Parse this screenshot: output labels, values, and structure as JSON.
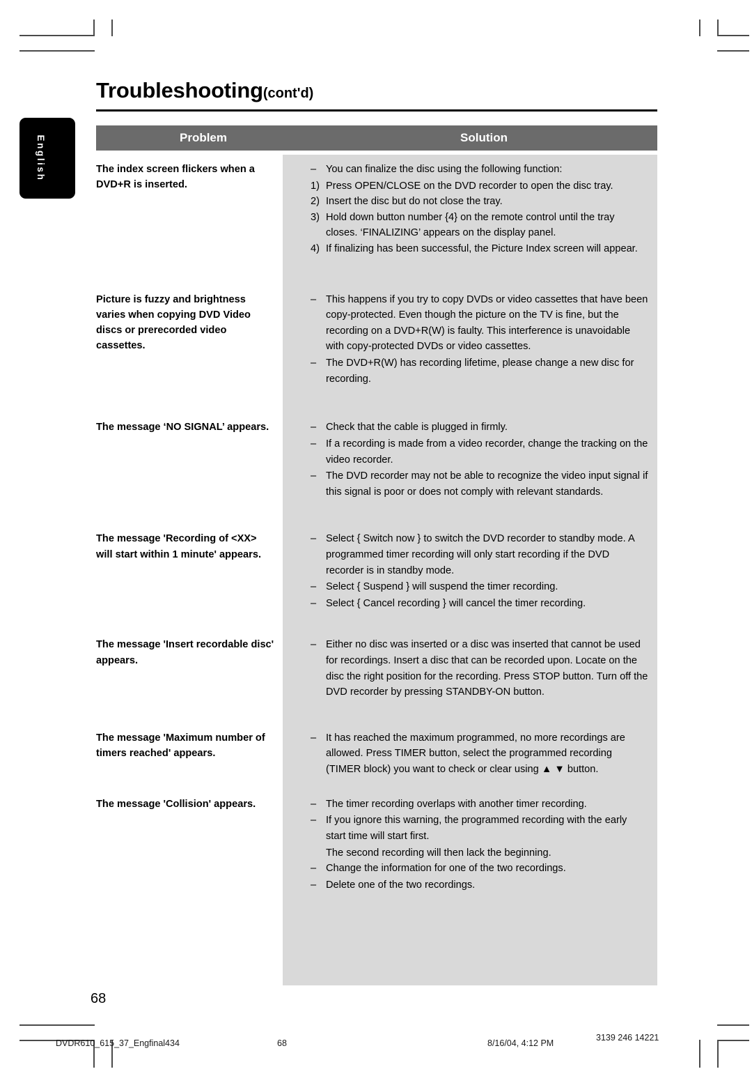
{
  "document": {
    "language_tab": "English",
    "title": "Troubleshooting",
    "title_suffix": "(cont'd)",
    "page_number": "68"
  },
  "colors": {
    "header_bar": "#6b6b6b",
    "solution_background": "#d9d9d9",
    "tab_background": "#000000",
    "text": "#000000"
  },
  "table": {
    "columns": {
      "problem": "Problem",
      "solution": "Solution"
    },
    "rows": [
      {
        "problem": "The index screen flickers when a DVD+R is inserted.",
        "solution_blocks": [
          {
            "kind": "bullet",
            "marker": "–",
            "text": "You can finalize the disc using the following function:"
          },
          {
            "kind": "numbered",
            "marker": "1)",
            "text": "Press OPEN/CLOSE on the DVD recorder to open the disc tray."
          },
          {
            "kind": "numbered",
            "marker": "2)",
            "text": "Insert the disc but do not close the tray."
          },
          {
            "kind": "numbered",
            "marker": "3)",
            "text": "Hold down button number {4} on the remote control until the tray closes. ‘FINALIZING’ appears on the display panel."
          },
          {
            "kind": "numbered",
            "marker": "4)",
            "text": "If finalizing has been successful, the Picture Index screen will appear."
          }
        ]
      },
      {
        "problem": "Picture is fuzzy and brightness varies when copying DVD Video discs or prerecorded video cassettes.",
        "solution_blocks": [
          {
            "kind": "bullet",
            "marker": "–",
            "text": "This happens if you try to copy DVDs or video cassettes that have been copy-protected.  Even though the picture on the TV is fine, but the recording on a DVD+R(W) is faulty. This interference is unavoidable with copy-protected DVDs or video cassettes."
          },
          {
            "kind": "bullet",
            "marker": "–",
            "text": "The DVD+R(W) has recording lifetime, please change a new disc for recording."
          }
        ]
      },
      {
        "problem": "The message ‘NO SIGNAL’ appears.",
        "solution_blocks": [
          {
            "kind": "bullet",
            "marker": "–",
            "text": "Check that the cable is plugged in firmly."
          },
          {
            "kind": "bullet",
            "marker": "–",
            "text": "If a recording is made from a video recorder, change the tracking on the video recorder."
          },
          {
            "kind": "bullet",
            "marker": "–",
            "text": "The DVD recorder may not be able to recognize the video input signal if this signal is poor or does not comply with relevant standards."
          }
        ]
      },
      {
        "problem": "The message 'Recording of <XX> will start within 1 minute' appears.",
        "solution_blocks": [
          {
            "kind": "bullet",
            "marker": "–",
            "text": "Select { Switch now } to switch the DVD recorder to standby mode. A programmed timer recording will only start recording if the DVD recorder is in standby mode."
          },
          {
            "kind": "bullet",
            "marker": "–",
            "text": "Select { Suspend } will suspend the timer recording."
          },
          {
            "kind": "bullet",
            "marker": "–",
            "text": "Select { Cancel recording } will cancel the timer recording."
          }
        ]
      },
      {
        "problem": "The message 'Insert recordable disc' appears.",
        "solution_blocks": [
          {
            "kind": "bullet",
            "marker": "–",
            "text": "Either no disc was inserted or a disc was inserted that cannot be used for recordings. Insert a disc that can be recorded upon. Locate on the disc the right position for the recording. Press STOP button. Turn off the DVD recorder by pressing STANDBY-ON button."
          }
        ]
      },
      {
        "problem": "The message 'Maximum number of timers reached' appears.",
        "solution_blocks": [
          {
            "kind": "bullet",
            "marker": "–",
            "text": "It has reached the maximum programmed, no more recordings are allowed. Press TIMER button, select the programmed recording (TIMER block) you want to check or clear using ▲ ▼ button."
          }
        ]
      },
      {
        "problem": "The message 'Collision' appears.",
        "solution_blocks": [
          {
            "kind": "bullet",
            "marker": "–",
            "text": "The timer recording overlaps with another timer recording."
          },
          {
            "kind": "bullet",
            "marker": "–",
            "text": "If you ignore this warning, the programmed recording with the early start time will start first."
          },
          {
            "kind": "plain",
            "marker": "",
            "text": "The second recording will then lack the beginning."
          },
          {
            "kind": "bullet",
            "marker": "–",
            "text": "Change the information for one of the two recordings."
          },
          {
            "kind": "bullet",
            "marker": "–",
            "text": "Delete one of the two recordings."
          }
        ]
      }
    ]
  },
  "footer": {
    "file_name": "DVDR610_615_37_Engfinal434",
    "page": "68",
    "timestamp": "8/16/04, 4:12 PM",
    "code": "3139 246 14221"
  }
}
